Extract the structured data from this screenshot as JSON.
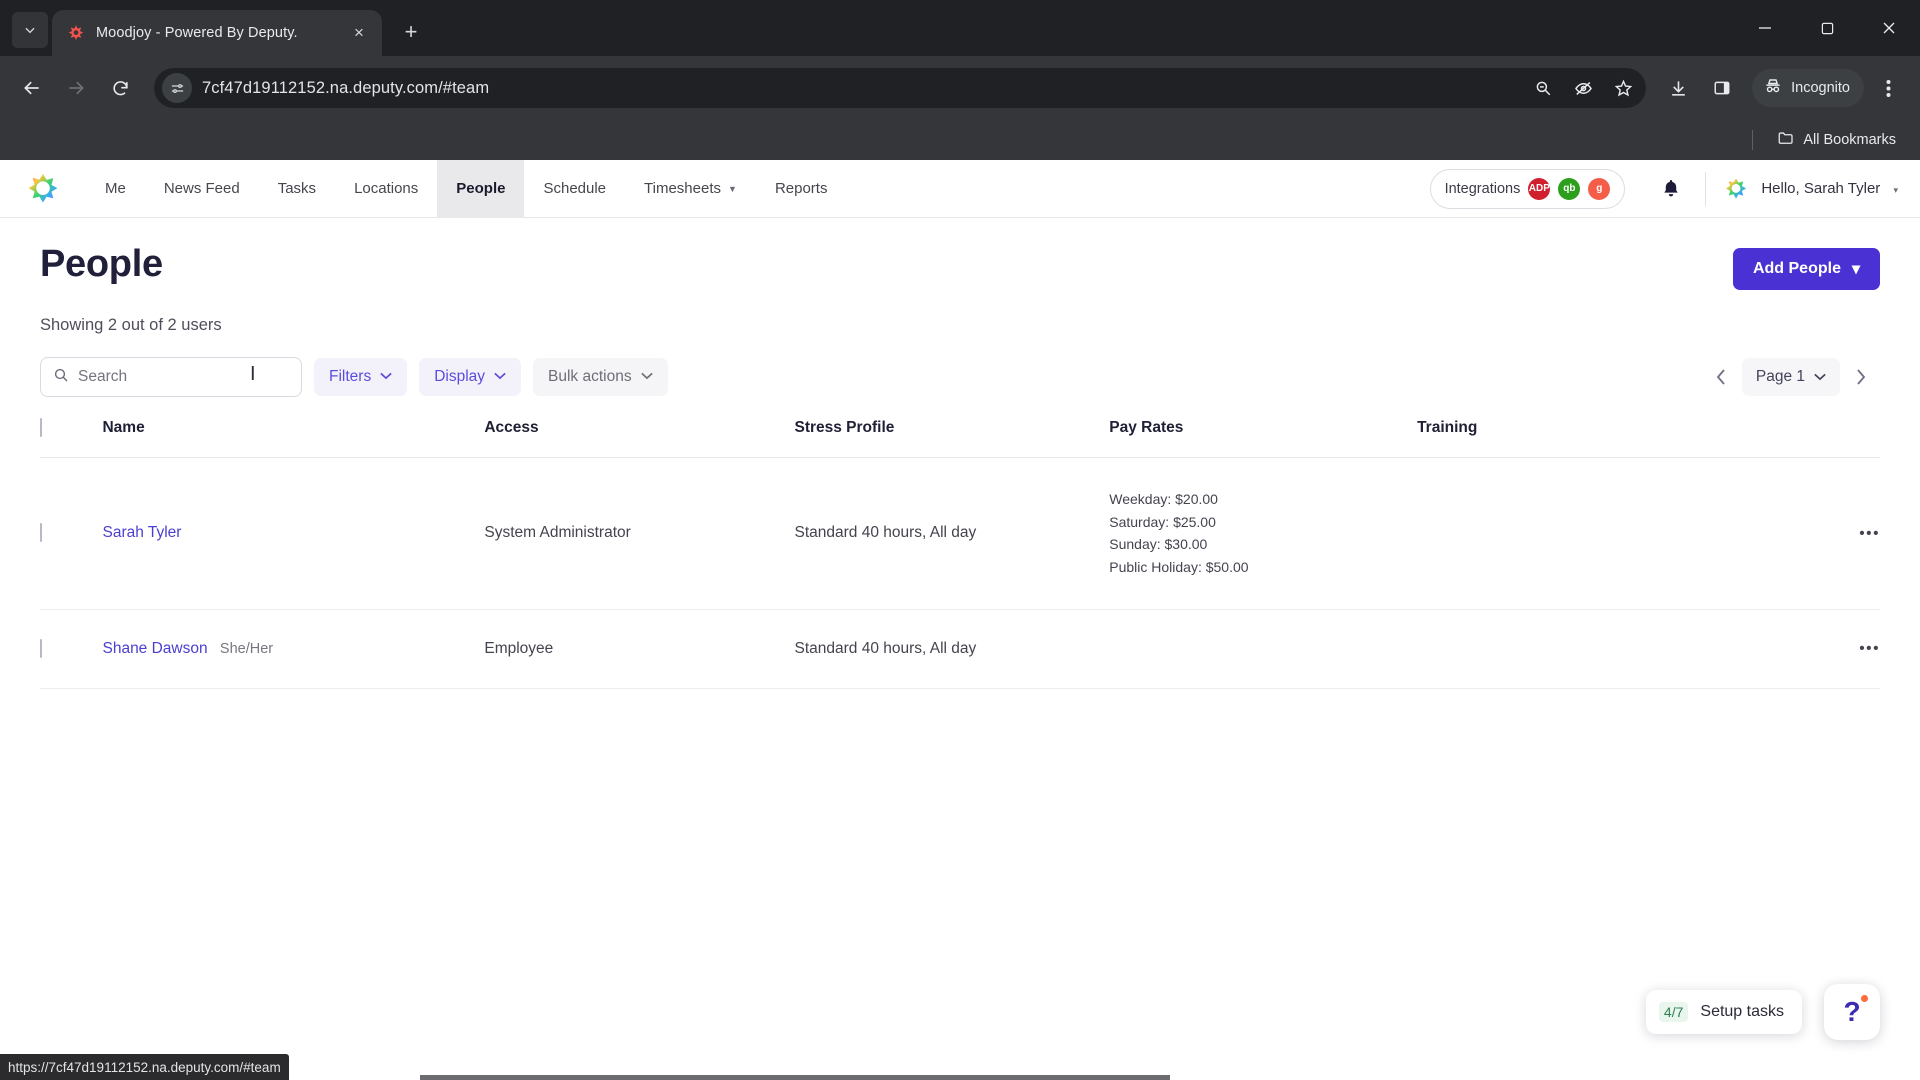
{
  "browser": {
    "tab": {
      "title": "Moodjoy - Powered By Deputy.",
      "favicon": "deputy-star-icon",
      "close_label": "×"
    },
    "new_tab_label": "+",
    "tab_search_icon": "chevron-down-icon",
    "window_controls": {
      "minimize": "—",
      "maximize": "❐",
      "close": "✕"
    },
    "omnibox": {
      "url": "7cf47d19112152.na.deputy.com/#team",
      "site_info_icon": "tune-icon",
      "right_icons": [
        "zoom-out-icon",
        "eye-off-icon",
        "star-icon"
      ]
    },
    "toolbar_icons": [
      "download-icon",
      "side-panel-icon"
    ],
    "incognito_label": "Incognito",
    "menu_icon": "kebab-menu-icon",
    "bookmarks": {
      "label": "All Bookmarks",
      "icon": "folder-icon"
    },
    "status_url": "https://7cf47d19112152.na.deputy.com/#team"
  },
  "app": {
    "logo": "deputy-rainbow-star-logo",
    "nav": [
      {
        "label": "Me",
        "active": false,
        "caret": false
      },
      {
        "label": "News Feed",
        "active": false,
        "caret": false
      },
      {
        "label": "Tasks",
        "active": false,
        "caret": false
      },
      {
        "label": "Locations",
        "active": false,
        "caret": false
      },
      {
        "label": "People",
        "active": true,
        "caret": false
      },
      {
        "label": "Schedule",
        "active": false,
        "caret": false
      },
      {
        "label": "Timesheets",
        "active": false,
        "caret": true
      },
      {
        "label": "Reports",
        "active": false,
        "caret": false
      }
    ],
    "integrations": {
      "label": "Integrations",
      "badges": [
        {
          "name": "adp",
          "text": "ADP",
          "color": "#d0202d"
        },
        {
          "name": "quickbooks",
          "text": "qb",
          "color": "#2ca01c"
        },
        {
          "name": "gusto",
          "text": "g",
          "color": "#f45d48"
        }
      ]
    },
    "notifications_icon": "bell-icon",
    "user": {
      "greeting": "Hello, Sarah Tyler",
      "avatar": "deputy-rainbow-star-avatar",
      "caret": "▾"
    }
  },
  "page": {
    "title": "People",
    "add_button": {
      "label": "Add People",
      "caret": "▾",
      "color": "#4a31d4"
    },
    "count_text": "Showing 2 out of 2 users",
    "search": {
      "placeholder": "Search",
      "value": "",
      "icon": "search-icon"
    },
    "filters_button": {
      "label": "Filters",
      "caret": "⌄"
    },
    "display_button": {
      "label": "Display",
      "caret": "⌄"
    },
    "bulk_actions_button": {
      "label": "Bulk actions",
      "caret": "⌄"
    },
    "pagination": {
      "prev": "‹",
      "next": "›",
      "page_label": "Page 1",
      "caret": "⌄"
    }
  },
  "table": {
    "columns": [
      "Name",
      "Access",
      "Stress Profile",
      "Pay Rates",
      "Training"
    ],
    "rows": [
      {
        "name": "Sarah Tyler",
        "pronouns": "",
        "access": "System Administrator",
        "stress_profile": "Standard 40 hours, All day",
        "pay_rates": [
          "Weekday: $20.00",
          "Saturday: $25.00",
          "Sunday: $30.00",
          "Public Holiday: $50.00"
        ],
        "training": "",
        "menu": "•••"
      },
      {
        "name": "Shane Dawson",
        "pronouns": "She/Her",
        "access": "Employee",
        "stress_profile": "Standard 40 hours, All day",
        "pay_rates": [],
        "training": "",
        "menu": "•••"
      }
    ]
  },
  "widgets": {
    "setup_tasks": {
      "fraction": "4/7",
      "label": "Setup tasks"
    },
    "help": {
      "glyph": "?",
      "icon": "help-icon"
    }
  }
}
